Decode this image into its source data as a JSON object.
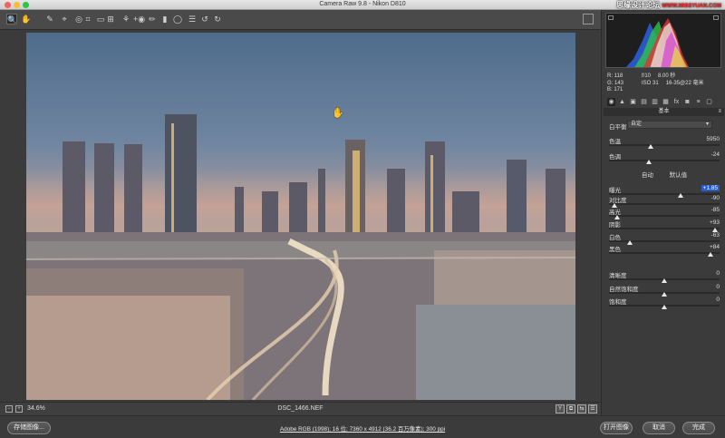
{
  "window": {
    "title": "Camera Raw 9.8 -  Nikon D810"
  },
  "watermark": {
    "text": "思缘设计论坛",
    "domain": "WWW.MISSYUAN.COM"
  },
  "toolbar": {
    "tools": [
      {
        "icon": "zoom-tool-icon",
        "glyph": "🔍",
        "active": true
      },
      {
        "icon": "hand-tool-icon",
        "glyph": "✋"
      },
      {
        "icon": "white-balance-tool-icon",
        "glyph": "✎"
      },
      {
        "icon": "color-sampler-tool-icon",
        "glyph": "⌖"
      },
      {
        "icon": "targeted-adjustment-tool-icon",
        "glyph": "◎"
      },
      {
        "icon": "crop-tool-icon",
        "glyph": "⌗"
      },
      {
        "icon": "straighten-tool-icon",
        "glyph": "▭"
      },
      {
        "icon": "transform-tool-icon",
        "glyph": "⊞"
      },
      {
        "icon": "spot-removal-tool-icon",
        "glyph": "⚘"
      },
      {
        "icon": "red-eye-tool-icon",
        "glyph": "+◉"
      },
      {
        "icon": "adjustment-brush-icon",
        "glyph": "✏"
      },
      {
        "icon": "graduated-filter-icon",
        "glyph": "▮"
      },
      {
        "icon": "radial-filter-icon",
        "glyph": "◯"
      },
      {
        "icon": "preferences-icon",
        "glyph": "☰"
      },
      {
        "icon": "rotate-ccw-icon",
        "glyph": "↺"
      },
      {
        "icon": "rotate-cw-icon",
        "glyph": "↻"
      }
    ]
  },
  "status": {
    "zoom": "34.6%",
    "filename": "DSC_1466.NEF",
    "view_buttons": [
      "Y",
      "⧉",
      "⇆",
      "☰"
    ]
  },
  "bottom": {
    "save_label": "存储图像...",
    "workflow_text": "Adobe RGB (1998); 16 位; 7360 x 4912 (36.2 百万像素); 300 ppi",
    "open_label": "打开图像",
    "cancel_label": "取消",
    "done_label": "完成"
  },
  "info": {
    "r": "R:   118",
    "g": "G:   143",
    "b": "B:   171",
    "aperture": "f/10",
    "shutter": "8.00 秒",
    "iso": "ISO 31",
    "lens": "16-35@22 毫米"
  },
  "panel": {
    "tabs": [
      "◉",
      "▲",
      "▣",
      "▤",
      "▥",
      "▦",
      "fx",
      "◙",
      "≡",
      "▢"
    ],
    "section_title": "基本",
    "wb_label": "白平衡:",
    "wb_value": "自定",
    "auto_label": "自动",
    "default_label": "默认值",
    "sliders": [
      {
        "id": "temperature",
        "label": "色温",
        "value": "5950",
        "pos": 0.38,
        "colors": [
          "#3b6fd8",
          "#e7d34c"
        ]
      },
      {
        "id": "tint",
        "label": "色调",
        "value": "-24",
        "pos": 0.36,
        "colors": [
          "#39c43b",
          "#c43bb7"
        ]
      },
      {
        "id": "exposure",
        "label": "曝光",
        "value": "+1.85",
        "pos": 0.65,
        "highlight": true
      },
      {
        "id": "contrast",
        "label": "对比度",
        "value": "-90",
        "pos": 0.05
      },
      {
        "id": "highlights",
        "label": "高光",
        "value": "-85",
        "pos": 0.07
      },
      {
        "id": "shadows",
        "label": "阴影",
        "value": "+93",
        "pos": 0.96
      },
      {
        "id": "whites",
        "label": "白色",
        "value": "-63",
        "pos": 0.19
      },
      {
        "id": "blacks",
        "label": "黑色",
        "value": "+84",
        "pos": 0.92
      },
      {
        "id": "clarity",
        "label": "清晰度",
        "value": "0",
        "pos": 0.5
      },
      {
        "id": "vibrance",
        "label": "自然饱和度",
        "value": "0",
        "pos": 0.5,
        "colors": [
          "#777",
          "#d64"
        ]
      },
      {
        "id": "saturation",
        "label": "饱和度",
        "value": "0",
        "pos": 0.5,
        "colors": [
          "#888",
          "#c3c"
        ]
      }
    ]
  }
}
